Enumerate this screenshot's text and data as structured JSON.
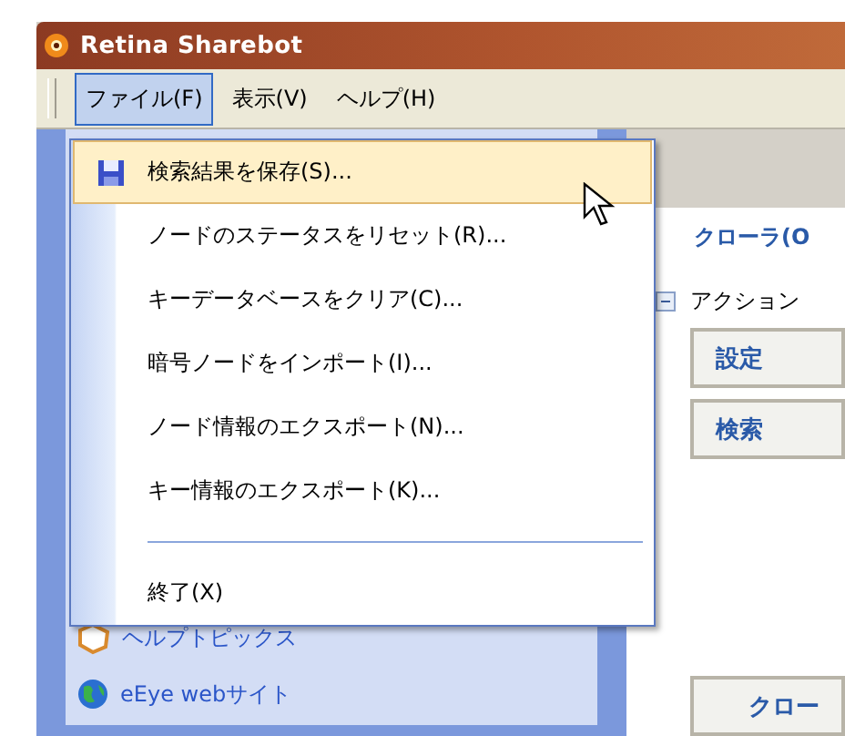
{
  "window": {
    "title": "Retina Sharebot"
  },
  "menu_bar": [
    {
      "label": "ファイル(F)",
      "selected": true
    },
    {
      "label": "表示(V)",
      "selected": false
    },
    {
      "label": "ヘルプ(H)",
      "selected": false
    }
  ],
  "file_menu": {
    "items": [
      {
        "kind": "item",
        "label": "検索結果を保存(S)...",
        "selected": true
      },
      {
        "kind": "item",
        "label": "ノードのステータスをリセット(R)...",
        "selected": false
      },
      {
        "kind": "item",
        "label": "キーデータベースをクリア(C)...",
        "selected": false
      },
      {
        "kind": "item",
        "label": "暗号ノードをインポート(I)...",
        "selected": false
      },
      {
        "kind": "item",
        "label": "ノード情報のエクスポート(N)...",
        "selected": false
      },
      {
        "kind": "item",
        "label": "キー情報のエクスポート(K)...",
        "selected": false
      },
      {
        "kind": "separator"
      },
      {
        "kind": "item",
        "label": "終了(X)",
        "selected": false
      }
    ]
  },
  "sidebar": {
    "links": [
      {
        "label": "ヘルプトピックス"
      },
      {
        "label": "eEye webサイト"
      }
    ]
  },
  "main": {
    "heading": "クローラ(O",
    "section": {
      "title": "アクション",
      "expanded": true
    },
    "buttons": [
      "設定",
      "検索"
    ],
    "bottom_button": "クロー"
  }
}
